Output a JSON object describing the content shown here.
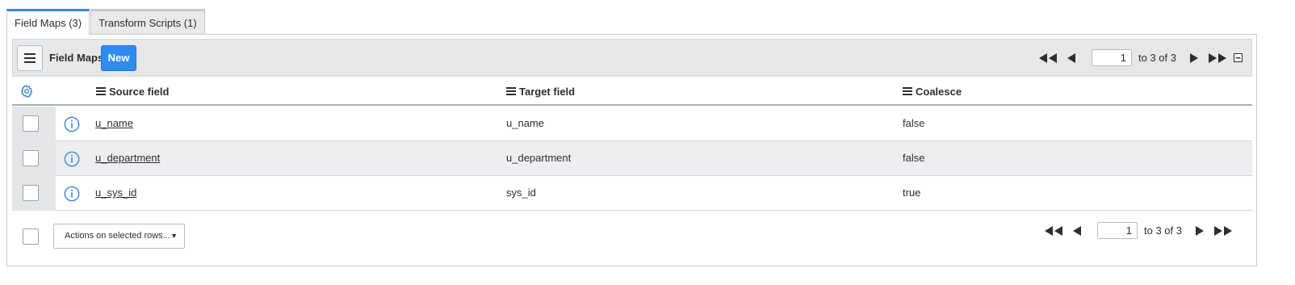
{
  "tabs": [
    {
      "label": "Field Maps (3)"
    },
    {
      "label": "Transform Scripts (1)"
    }
  ],
  "toolbar": {
    "title": "Field Maps",
    "new_label": "New"
  },
  "pager_top": {
    "page": "1",
    "range": "to 3 of 3"
  },
  "pager_bottom": {
    "page": "1",
    "range": "to 3 of 3"
  },
  "columns": [
    "Source field",
    "Target field",
    "Coalesce"
  ],
  "rows": [
    {
      "source": "u_name",
      "target": "u_name",
      "coalesce": "false"
    },
    {
      "source": "u_department",
      "target": "u_department",
      "coalesce": "false"
    },
    {
      "source": "u_sys_id",
      "target": "sys_id",
      "coalesce": "true"
    }
  ],
  "actions": {
    "label": "Actions on selected rows..."
  },
  "colors": {
    "accent": "#2c8cf0",
    "tab_active": "#3b86d9",
    "icon_blue": "#3b86d9"
  },
  "icons": [
    "menu-icon",
    "gear-icon",
    "info-icon",
    "first-page-icon",
    "prev-page-icon",
    "next-page-icon",
    "last-page-icon",
    "collapse-icon",
    "caret-down-icon"
  ]
}
